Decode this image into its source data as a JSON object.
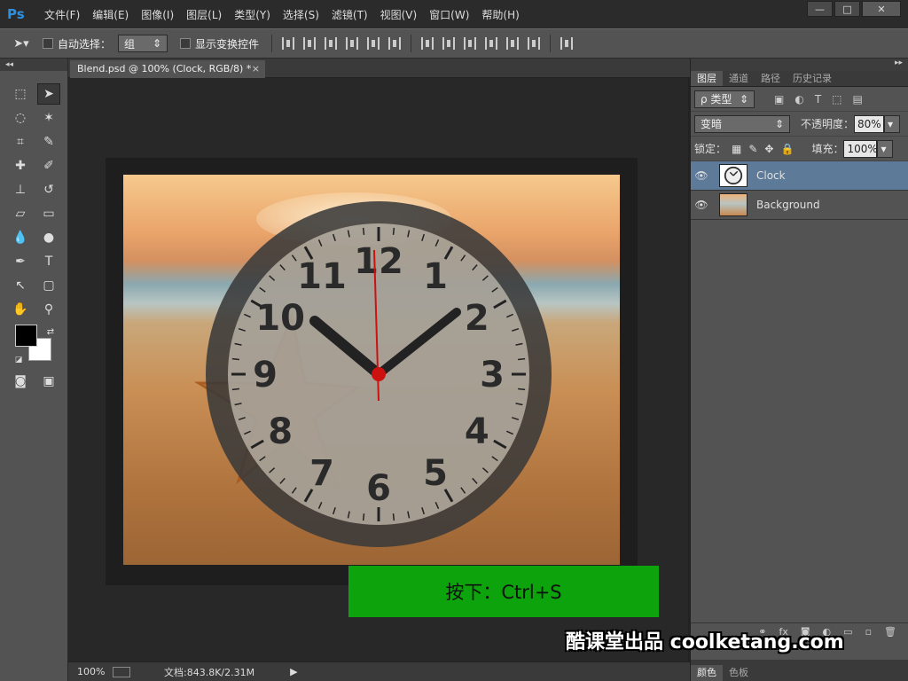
{
  "app": {
    "logo": "Ps"
  },
  "menu": {
    "items": [
      "文件(F)",
      "编辑(E)",
      "图像(I)",
      "图层(L)",
      "类型(Y)",
      "选择(S)",
      "滤镜(T)",
      "视图(V)",
      "窗口(W)",
      "帮助(H)"
    ]
  },
  "window_controls": {
    "minimize": "—",
    "maximize": "□",
    "close": "✕"
  },
  "options": {
    "auto_select_label": "自动选择：",
    "auto_select_value": "组",
    "show_transform_label": "显示变换控件"
  },
  "document": {
    "tab_title": "Blend.psd @ 100% (Clock, RGB/8) *",
    "tab_close": "×"
  },
  "clock_numerals": [
    "12",
    "1",
    "2",
    "3",
    "4",
    "5",
    "6",
    "7",
    "8",
    "9",
    "10",
    "11"
  ],
  "status": {
    "zoom": "100%",
    "doc_info": "文档:843.8K/2.31M"
  },
  "hint_text": "按下：Ctrl+S",
  "watermark": "酷课堂出品 coolketang.com",
  "panel": {
    "tabs": [
      "图层",
      "通道",
      "路径",
      "历史记录"
    ],
    "filter_label": "ρ 类型",
    "blend_mode": "变暗",
    "opacity_label": "不透明度：",
    "opacity_value": "80%",
    "lock_label": "锁定：",
    "fill_label": "填充：",
    "fill_value": "100%",
    "layers": [
      {
        "name": "Clock",
        "selected": true
      },
      {
        "name": "Background",
        "selected": false
      }
    ],
    "bottom_tabs": [
      "颜色",
      "色板"
    ]
  },
  "colors": {
    "accent": "#5d7a99",
    "hint_bg": "#0ca30c",
    "clock_hand_second": "#cc1111"
  }
}
